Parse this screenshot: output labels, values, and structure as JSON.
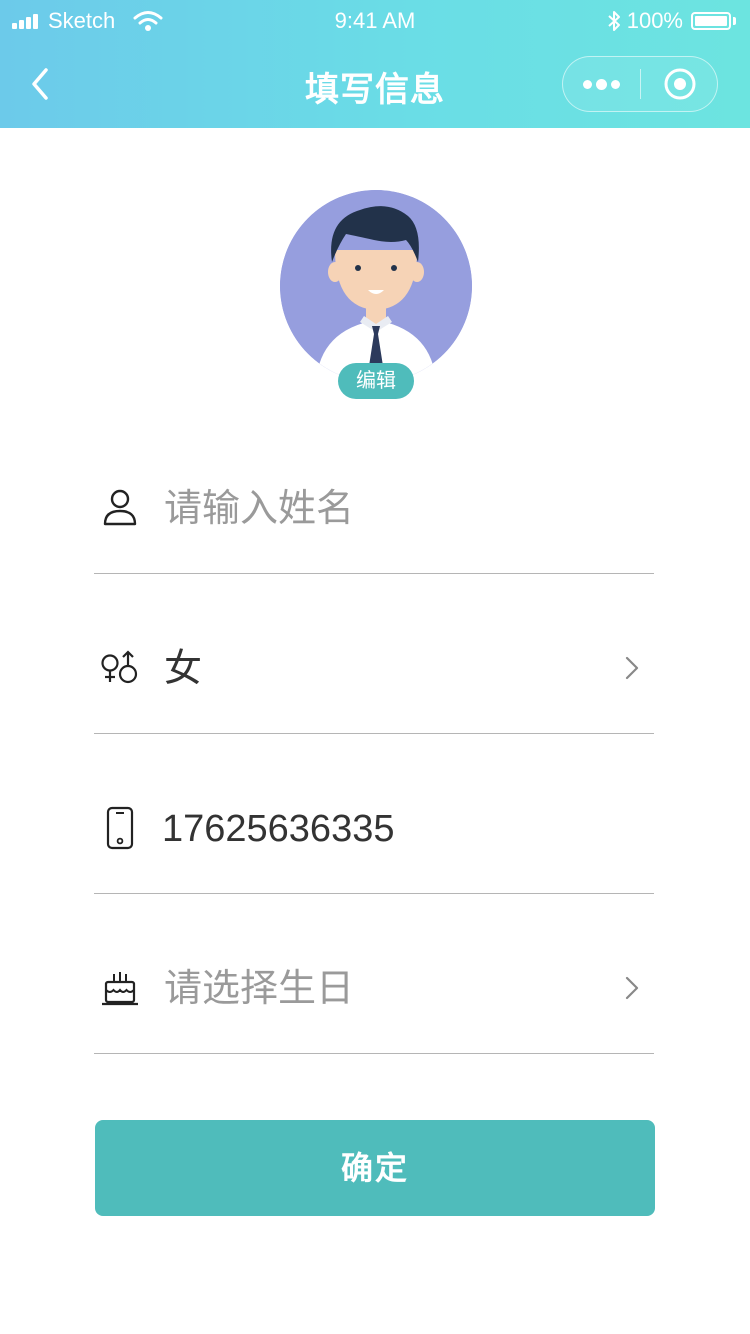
{
  "status_bar": {
    "carrier": "Sketch",
    "time": "9:41 AM",
    "battery": "100%"
  },
  "nav": {
    "title": "填写信息"
  },
  "profile": {
    "edit_label": "编辑"
  },
  "form": {
    "name_placeholder": "请输入姓名",
    "gender_value": "女",
    "phone_value": "17625636335",
    "birthday_placeholder": "请选择生日"
  },
  "actions": {
    "confirm_label": "确定"
  },
  "colors": {
    "accent": "#4fbcbb",
    "header_gradient_start": "#6ccaea",
    "header_gradient_end": "#6ce4e0",
    "avatar_background": "#969ede",
    "placeholder_text": "#9a9a9a",
    "divider": "#b5b5b5"
  },
  "icons": {
    "back": "chevron-left-icon",
    "more": "more-dots-icon",
    "close": "target-circle-icon",
    "name": "user-icon",
    "gender": "gender-icon",
    "phone": "phone-icon",
    "birthday": "cake-icon",
    "arrow": "chevron-right-icon"
  }
}
